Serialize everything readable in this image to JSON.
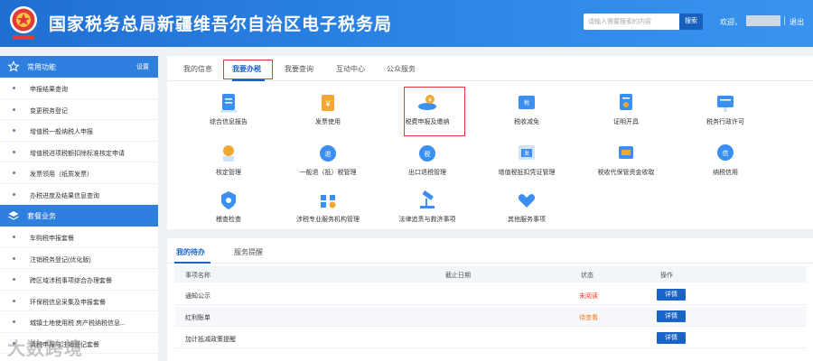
{
  "header": {
    "title": "国家税务总局新疆维吾尔自治区电子税务局",
    "search_placeholder": "请输入需要搜索的内容",
    "search_button": "搜索",
    "welcome": "欢迎，",
    "logout": "退出"
  },
  "sidebar": {
    "group1": {
      "title": "常用功能",
      "settings": "设置",
      "items": [
        "申报结果查询",
        "变更税务登记",
        "增值税一般纳税人申报",
        "增值税进项税额扣除标准核定申请",
        "发票领用（纸质发票）",
        "办税进度及结果信息查询"
      ]
    },
    "group2": {
      "title": "套餐业务",
      "items": [
        "车购税申报套餐",
        "注销税务登记(优化版)",
        "跨区域涉税事项综合办理套餐",
        "环保税信息采集及申报套餐",
        "城镇土地使用税 房产税纳税信息...",
        "清税申报与注销登记套餐"
      ]
    }
  },
  "main": {
    "tabs": [
      "我的信息",
      "我要办税",
      "我要查询",
      "互动中心",
      "公众服务"
    ],
    "grid": [
      "综合信息报告",
      "发票使用",
      "税费申报及缴纳",
      "税收减免",
      "证明开具",
      "税务行政许可",
      "核定管理",
      "一般退（抵）税管理",
      "出口退税管理",
      "增值税抵扣凭证管理",
      "税收代保管资金收取",
      "纳税信用",
      "稽查检查",
      "涉税专业服务机构管理",
      "法律追责与救济事项",
      "其他服务事项"
    ]
  },
  "todo": {
    "tabs": [
      "我的待办",
      "服务提醒"
    ],
    "headers": [
      "事项名称",
      "截止日期",
      "状态",
      "操作"
    ],
    "rows": [
      {
        "name": "通知公示",
        "status": "未阅读",
        "action": "详情"
      },
      {
        "name": "红利账单",
        "status": "待查看",
        "action": "详情"
      },
      {
        "name": "加计抵减政策提醒",
        "status": "",
        "action": "详情"
      }
    ]
  },
  "watermark": "大数跨境",
  "colors": {
    "brand_blue": "#1f6fd1",
    "highlight_red": "#e53935",
    "status_red": "#e53935",
    "status_orange": "#e67e22"
  }
}
